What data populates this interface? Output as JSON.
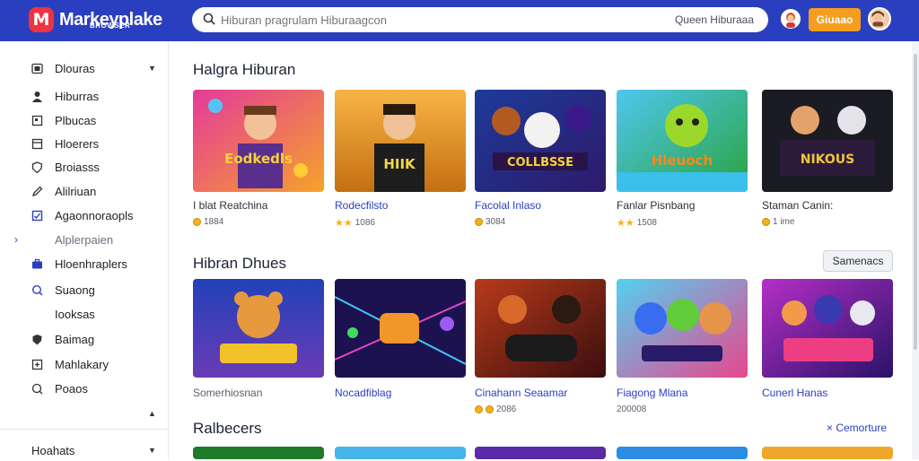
{
  "app": {
    "name": "Markeyplake",
    "subtitle": "BROWSER",
    "logo_letter": "M",
    "brand_color": "#2a3fbf",
    "accent_color": "#f59d1e"
  },
  "search": {
    "placeholder": "Hiburan pragrulam Hiburaagcon",
    "scope_label": "Queen Hiburaaa"
  },
  "header": {
    "cta_label": "Giuaao"
  },
  "sidebar": {
    "items": [
      {
        "label": "Dlouras",
        "icon": "dashboard-icon",
        "active": true
      },
      {
        "label": "Hiburras",
        "icon": "person-icon"
      },
      {
        "label": "Plbucas",
        "icon": "square-icon"
      },
      {
        "label": "Hloerers",
        "icon": "window-icon"
      },
      {
        "label": "Broiasss",
        "icon": "shield-icon"
      },
      {
        "label": "Alilriuan",
        "icon": "pen-icon"
      },
      {
        "label": "Agaonnoraopls",
        "icon": "checklist-icon"
      },
      {
        "label": "Alplerpaien",
        "icon": "none"
      },
      {
        "label": "Hloenhraplers",
        "icon": "briefcase-icon"
      },
      {
        "label": "Suaong",
        "icon": "search-icon"
      },
      {
        "label": "Iooksas",
        "icon": "none"
      },
      {
        "label": "Baimag",
        "icon": "shield-icon"
      },
      {
        "label": "Mahlakary",
        "icon": "plus-icon"
      },
      {
        "label": "Poaos",
        "icon": "chat-icon"
      }
    ],
    "footer_label": "Hoahats"
  },
  "sections": [
    {
      "title": "Halgra Hiburan",
      "cards": [
        {
          "title": "I blat Reatchina",
          "meta": "1884",
          "badge": "coin"
        },
        {
          "title": "Rodecfilsto",
          "meta": "1086",
          "badge": "stars"
        },
        {
          "title": "Facolal Inlaso",
          "meta": "3084",
          "badge": "coin"
        },
        {
          "title": "Fanlar Pisnbang",
          "meta": "1508",
          "badge": "stars"
        },
        {
          "title": "Staman Canin:",
          "meta": "1 ime",
          "badge": "coin"
        }
      ]
    },
    {
      "title": "Hibran Dhues",
      "action_label": "Samenacs",
      "cards": [
        {
          "title": "Somerhiosnan",
          "meta": ""
        },
        {
          "title": "Nocadfiblag",
          "meta": ""
        },
        {
          "title": "Cinahann Seaamar",
          "meta": "2086"
        },
        {
          "title": "Fiagong Mlana",
          "meta": "200008"
        },
        {
          "title": "Cunerl Hanas",
          "meta": ""
        }
      ]
    },
    {
      "title": "Ralbecers",
      "action_label": "Cemorture"
    }
  ],
  "card_texts": {
    "c1": "Eodkedls",
    "c2": "HIIK",
    "c3": "COLLBSSE",
    "c4": "Hleuoch",
    "c5": "NIKOUS"
  }
}
